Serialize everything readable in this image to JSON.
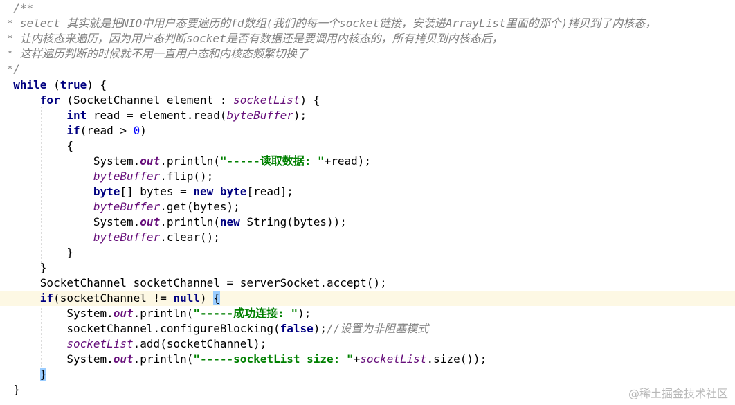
{
  "code": {
    "comment_open": "/**",
    "comment_line1": " * select 其实就是把NIO中用户态要遍历的fd数组(我们的每一个socket链接，安装进ArrayList里面的那个)拷贝到了内核态，",
    "comment_line2": " * 让内核态来遍历，因为用户态判断socket是否有数据还是要调用内核态的，所有拷贝到内核态后，",
    "comment_line3": " * 这样遍历判断的时候就不用一直用户态和内核态频繁切换了",
    "comment_close": " */",
    "kw_while": "while",
    "kw_true": "true",
    "kw_for": "for",
    "kw_int": "int",
    "kw_if": "if",
    "kw_byte": "byte",
    "kw_new": "new",
    "kw_null": "null",
    "kw_false": "false",
    "f_socketList": "socketList",
    "f_byteBuffer": "byteBuffer",
    "f_out": "out",
    "num_zero": "0",
    "str_read": "\"-----读取数据: \"",
    "str_connect": "\"-----成功连接: \"",
    "str_size": "\"-----socketList size: \"",
    "t_open_brace": "{",
    "t_close_brace": "}",
    "t_while_pre": " (",
    "t_while_post": ") {",
    "t_for_pre": " (SocketChannel element : ",
    "t_for_post": ") {",
    "t_int_rest": " read = element.read(",
    "t_close_paren_semi": ");",
    "t_if_read_pre": "(read > ",
    "t_close_paren": ")",
    "t_system": "System.",
    "t_println_open": ".println(",
    "t_plus_read": "+read);",
    "t_flip": ".flip();",
    "t_byte_arr": "[] bytes = ",
    "t_space": " ",
    "t_byte_arr_end": "[read];",
    "t_get": ".get(bytes);",
    "t_new_string_pre": ".println(",
    "t_new_string_post": " String(bytes));",
    "t_clear": ".clear();",
    "t_accept": "SocketChannel socketChannel = serverSocket.accept();",
    "t_if_sc_pre": "(socketChannel != ",
    "t_if_sc_post": ") ",
    "t_configure": "socketChannel.configureBlocking(",
    "t_configure_end": ");",
    "cm_nonblock": "//设置为非阻塞模式",
    "t_add": ".add(socketChannel);",
    "t_plus": "+",
    "t_size": ".size());"
  },
  "watermark": "@稀土掘金技术社区"
}
